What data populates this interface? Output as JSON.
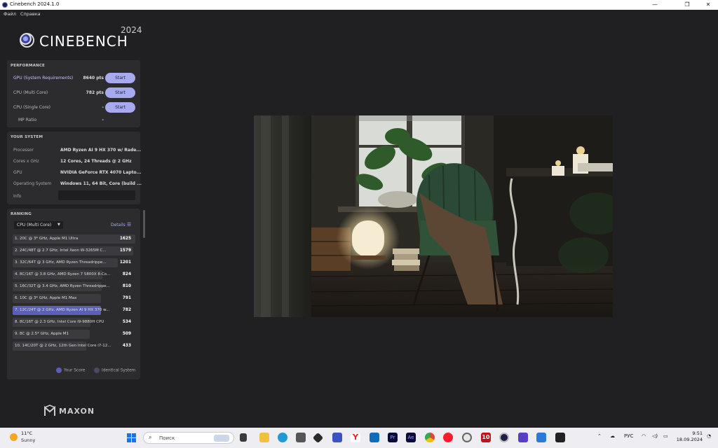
{
  "window": {
    "title": "Cinebench 2024.1.0",
    "controls": {
      "minimize": "—",
      "maximize": "❐",
      "close": "✕"
    }
  },
  "menu": {
    "file": "Файл",
    "help": "Справка"
  },
  "logo": {
    "name": "CINEBENCH",
    "year": "2024"
  },
  "performance": {
    "heading": "PERFORMANCE",
    "rows": [
      {
        "label": "GPU (System Requirements)",
        "value": "8640 pts",
        "button": "Start"
      },
      {
        "label": "CPU (Multi Core)",
        "value": "782 pts",
        "button": "Start"
      },
      {
        "label": "CPU (Single Core)",
        "value": "-",
        "button": "Start"
      }
    ],
    "mp_ratio_label": "MP Ratio",
    "mp_ratio_value": "-"
  },
  "system": {
    "heading": "YOUR SYSTEM",
    "rows": [
      {
        "label": "Processor",
        "value": "AMD Ryzen AI 9 HX 370 w/ Rade..."
      },
      {
        "label": "Cores x GHz",
        "value": "12 Cores, 24 Threads @ 2 GHz"
      },
      {
        "label": "GPU",
        "value": "NVIDIA GeForce RTX 4070 Lapto..."
      },
      {
        "label": "Operating System",
        "value": "Windows 11, 64 Bit, Core (build ..."
      }
    ],
    "info_label": "Info"
  },
  "ranking": {
    "heading": "RANKING",
    "dropdown": "CPU (Multi Core)",
    "details": "Details",
    "max": 1625,
    "rows": [
      {
        "label": "1. 20C @ 3* GHz, Apple M1 Ultra",
        "score": 1625,
        "mine": false
      },
      {
        "label": "2. 24C/48T @ 2.7 GHz, Intel Xeon W-3265M C...",
        "score": 1579,
        "mine": false
      },
      {
        "label": "3. 32C/64T @ 3 GHz, AMD Ryzen Threadrippe...",
        "score": 1201,
        "mine": false
      },
      {
        "label": "4. 8C/16T @ 3.8 GHz, AMD Ryzen 7 5800X 8-Co...",
        "score": 824,
        "mine": false
      },
      {
        "label": "5. 16C/32T @ 3.4 GHz, AMD Ryzen Threadrippe...",
        "score": 810,
        "mine": false
      },
      {
        "label": "6. 10C @ 3* GHz, Apple M1 Max",
        "score": 791,
        "mine": false
      },
      {
        "label": "7. 12C/24T @ 2 GHz, AMD Ryzen AI 9 HX 370 w...",
        "score": 782,
        "mine": true
      },
      {
        "label": "8. 8C/16T @ 2.3 GHz, Intel Core i9-9880H CPU",
        "score": 534,
        "mine": false
      },
      {
        "label": "9. 8C @ 2.5* GHz, Apple M1",
        "score": 509,
        "mine": false
      },
      {
        "label": "10. 14C/20T @ 2 GHz, 12th Gen Intel Core i7-12...",
        "score": 433,
        "mine": false
      }
    ],
    "legend_your": "Your Score",
    "legend_identical": "Identical System"
  },
  "brand": {
    "maxon": "MAXON"
  },
  "taskbar": {
    "temp": "11°C",
    "condition": "Sunny",
    "search_placeholder": "Поиск",
    "lang": "РУС",
    "time": "9:51",
    "date": "18.09.2024",
    "app_badge": "10"
  },
  "colors": {
    "accent": "#a8aaf0",
    "my_score": "#5b5fb6",
    "panel": "#2c2c2f"
  }
}
